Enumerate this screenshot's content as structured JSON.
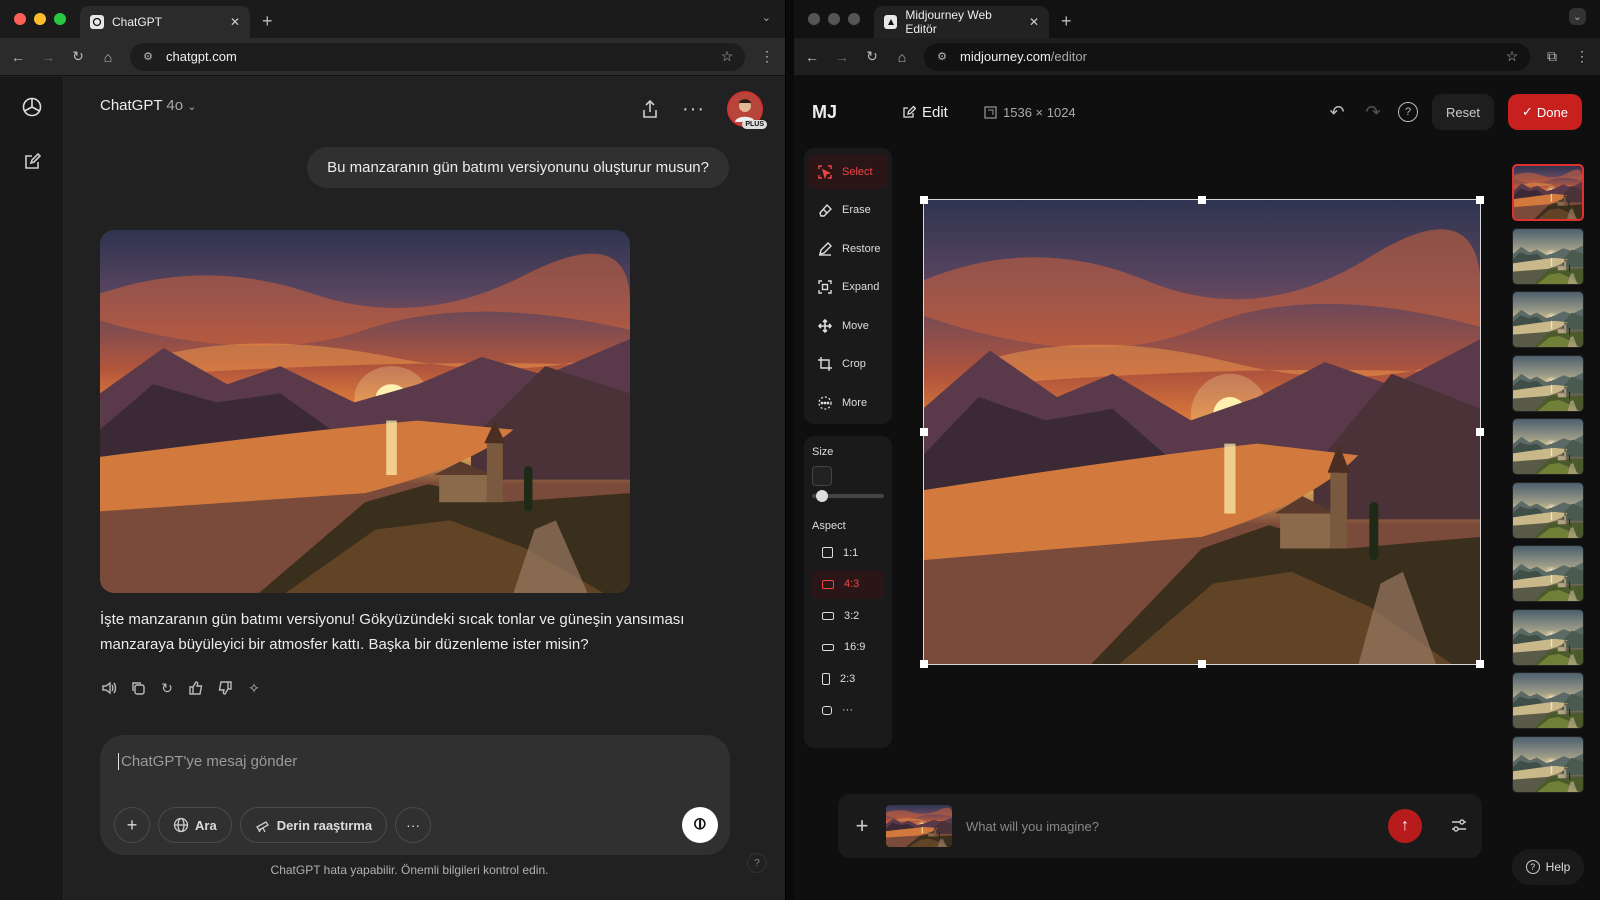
{
  "left_browser": {
    "tab_title": "ChatGPT",
    "url": "chatgpt.com",
    "chat": {
      "model_name": "ChatGPT",
      "model_version": "4o",
      "plus_badge": "PLUS",
      "user_message": "Bu manzaranın gün batımı versiyonunu oluşturur musun?",
      "assistant_message": "İşte manzaranın gün batımı versiyonu! Gökyüzündeki sıcak tonlar ve güneşin yansıması manzaraya büyüleyici bir atmosfer kattı. Başka bir düzenleme ister misin?",
      "composer_placeholder": "ChatGPT'ye mesaj gönder",
      "search_label": "Ara",
      "deep_research_label": "Derin raaştırma",
      "disclaimer": "ChatGPT hata yapabilir. Önemli bilgileri kontrol edin.",
      "help_mark": "?"
    }
  },
  "right_browser": {
    "tab_title": "Midjourney Web Editör",
    "url_host": "midjourney.com",
    "url_path": "/editor",
    "editor": {
      "logo": "MJ",
      "edit_label": "Edit",
      "size_label": "1536 × 1024",
      "reset_label": "Reset",
      "done_label": "Done",
      "tools": [
        "Select",
        "Erase",
        "Restore",
        "Expand",
        "Move",
        "Crop",
        "More"
      ],
      "size_heading": "Size",
      "aspect_heading": "Aspect",
      "aspects": [
        "1:1",
        "4:3",
        "3:2",
        "16:9",
        "2:3",
        "···"
      ],
      "active_aspect": "4:3",
      "prompt_placeholder": "What will you imagine?",
      "help_label": "Help",
      "thumbnail_count": 10
    }
  },
  "colors": {
    "accent_red": "#c81f1f",
    "chat_bg": "#212121"
  }
}
